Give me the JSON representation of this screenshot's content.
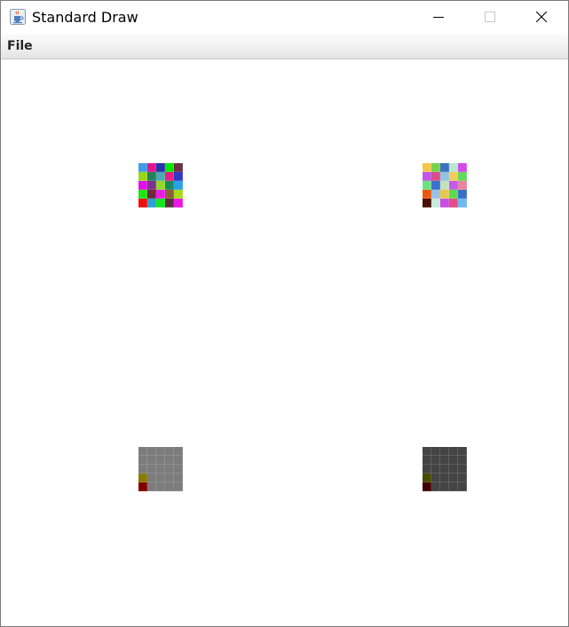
{
  "window": {
    "title": "Standard Draw"
  },
  "menu": {
    "items": [
      "File"
    ]
  },
  "icons": {
    "app": "java-cup-icon",
    "minimize": "minimize-icon",
    "maximize": "maximize-icon",
    "close": "close-icon"
  },
  "grids": [
    {
      "name": "color-grid-a",
      "cells": [
        [
          "#3d9ee6",
          "#e0178b",
          "#2633a8",
          "#00e800",
          "#6b2f45"
        ],
        [
          "#9ad51c",
          "#27815a",
          "#4ea8b6",
          "#ec1e7d",
          "#2f37c3"
        ],
        [
          "#e011e6",
          "#7f2f91",
          "#93d62d",
          "#1a8a5b",
          "#29a2e8"
        ],
        [
          "#1fe514",
          "#6a2a3a",
          "#ea1de6",
          "#8a5d3b",
          "#a8d91b"
        ],
        [
          "#f00f0f",
          "#2f9fd4",
          "#12e81a",
          "#5a2f3c",
          "#eb17e9"
        ]
      ]
    },
    {
      "name": "color-grid-b",
      "cells": [
        [
          "#f1c84c",
          "#74d34a",
          "#3e72bc",
          "#b9e6cc",
          "#d34be6"
        ],
        [
          "#c255e6",
          "#d74e8e",
          "#93c3de",
          "#f2cb5a",
          "#63d95a"
        ],
        [
          "#6ee084",
          "#3e6ecd",
          "#c3e1bd",
          "#c35de8",
          "#e9839f"
        ],
        [
          "#e85b0c",
          "#99c1e8",
          "#e5c84f",
          "#61d84f",
          "#376ec8"
        ],
        [
          "#4a1006",
          "#c8e9dd",
          "#c84fe6",
          "#e44e86",
          "#6fb9f0"
        ]
      ]
    },
    {
      "name": "gray-grid-a",
      "cells": [
        [
          "#7c7c7c",
          "#7c7c7c",
          "#7c7c7c",
          "#7c7c7c",
          "#7c7c7c"
        ],
        [
          "#7c7c7c",
          "#7c7c7c",
          "#7c7c7c",
          "#7c7c7c",
          "#7c7c7c"
        ],
        [
          "#7c7c7c",
          "#7c7c7c",
          "#7c7c7c",
          "#7c7c7c",
          "#7c7c7c"
        ],
        [
          "#8a7a00",
          "#7c7c7c",
          "#7c7c7c",
          "#7c7c7c",
          "#7c7c7c"
        ],
        [
          "#800000",
          "#7c7c7c",
          "#7c7c7c",
          "#7c7c7c",
          "#7c7c7c"
        ]
      ]
    },
    {
      "name": "gray-grid-b",
      "cells": [
        [
          "#444444",
          "#444444",
          "#444444",
          "#444444",
          "#444444"
        ],
        [
          "#444444",
          "#444444",
          "#444444",
          "#444444",
          "#444444"
        ],
        [
          "#444444",
          "#444444",
          "#444444",
          "#444444",
          "#444444"
        ],
        [
          "#4a4a00",
          "#444444",
          "#444444",
          "#444444",
          "#444444"
        ],
        [
          "#400000",
          "#444444",
          "#444444",
          "#444444",
          "#444444"
        ]
      ]
    }
  ]
}
